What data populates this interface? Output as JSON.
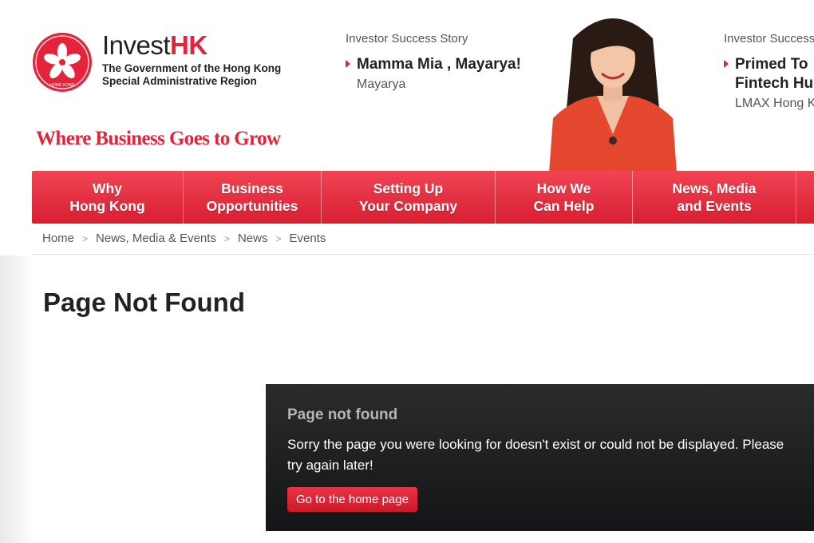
{
  "header": {
    "brand_prefix": "Invest",
    "brand_suffix": "HK",
    "gov_line1": "The Government of the Hong Kong",
    "gov_line2": "Special Administrative Region",
    "tagline": "Where Business Goes to Grow",
    "emblem_text": "HONG KONG"
  },
  "stories": [
    {
      "kicker": "Investor Success Story",
      "title": "Mamma Mia , Mayarya!",
      "title_line2": "",
      "sub": "Mayarya"
    },
    {
      "kicker": "Investor Success Story",
      "title": "Primed To",
      "title_line2": "Fintech Hu",
      "sub": "LMAX Hong K"
    }
  ],
  "nav": [
    {
      "line1": "Why",
      "line2": "Hong Kong"
    },
    {
      "line1": "Business",
      "line2": "Opportunities"
    },
    {
      "line1": "Setting Up",
      "line2": "Your Company"
    },
    {
      "line1": "How We",
      "line2": "Can Help"
    },
    {
      "line1": "News, Media",
      "line2": "and Events"
    },
    {
      "line1": "",
      "line2": ""
    }
  ],
  "breadcrumb": [
    "Home",
    "News, Media & Events",
    "News",
    "Events"
  ],
  "breadcrumb_sep": ">",
  "page_title": "Page Not Found",
  "error": {
    "heading": "Page not found",
    "message": "Sorry the page you were looking for doesn't exist or could not be displayed. Please try again later!",
    "button": "Go to the home page"
  },
  "colors": {
    "brand_red": "#e5243b",
    "panel_dark": "#1f2022"
  }
}
